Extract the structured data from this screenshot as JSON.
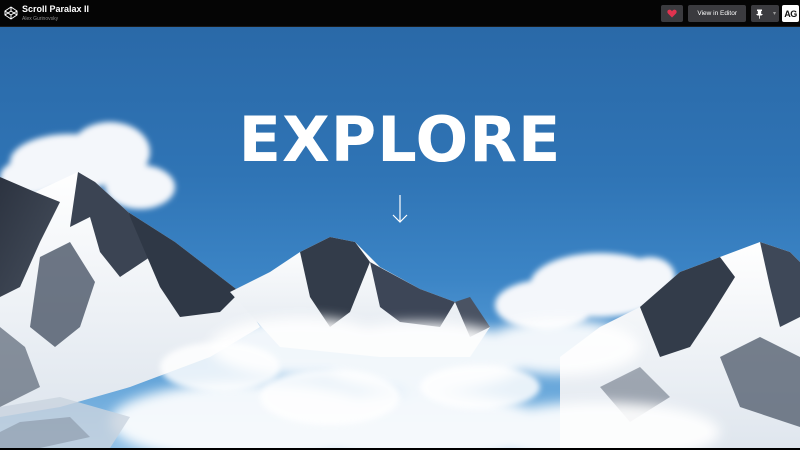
{
  "pen": {
    "title": "Scroll Paralax II",
    "author": "Alex Gurinovsky"
  },
  "actions": {
    "editor_label": "View in Editor",
    "avatar_initials": "AG"
  },
  "hero": {
    "headline": "EXPLORE"
  },
  "colors": {
    "topbar": "#050505",
    "button": "#3b3b3f",
    "heart": "#e0334f",
    "sky_top": "#2a69a8",
    "sky_bottom": "#8fc0e6"
  },
  "icons": [
    "codepen-logo-icon",
    "heart-icon",
    "pin-icon",
    "chevron-down-icon",
    "arrow-down-icon"
  ]
}
